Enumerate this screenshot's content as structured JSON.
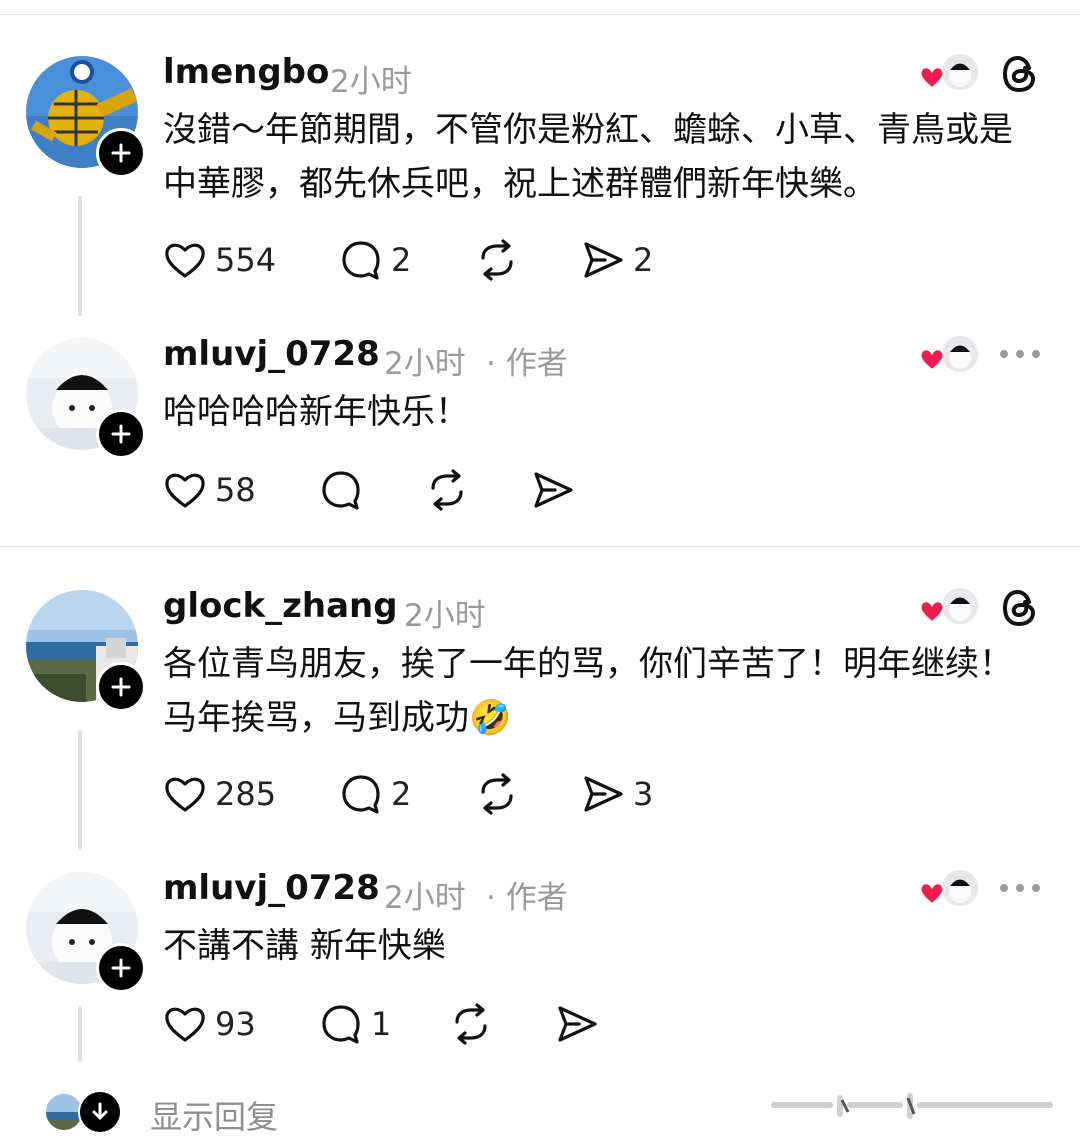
{
  "posts": [
    {
      "username": "lmengbo",
      "time": "2小时",
      "body": "沒錯～年節期間，不管你是粉紅、蟾蜍、小草、青鳥或是中華膠，都先休兵吧，祝上述群體們新年快樂。",
      "likes": "554",
      "comments": "2",
      "reposts": "",
      "shares": "2",
      "corner_icon": "threads-logo-icon"
    },
    {
      "username": "mluvj_0728",
      "time": "2小时",
      "author_tag": "· 作者",
      "body": "哈哈哈哈新年快乐！",
      "likes": "58",
      "comments": "",
      "reposts": "",
      "shares": "",
      "corner_icon": "more-icon"
    },
    {
      "username": "glock_zhang",
      "time": "2小时",
      "body": "各位青鸟朋友，挨了一年的骂，你们辛苦了！明年继续！马年挨骂，马到成功🤣",
      "likes": "285",
      "comments": "2",
      "reposts": "",
      "shares": "3",
      "corner_icon": "threads-logo-icon"
    },
    {
      "username": "mluvj_0728",
      "time": "2小时",
      "author_tag": "· 作者",
      "body": "不講不講 新年快樂",
      "likes": "93",
      "comments": "1",
      "reposts": "",
      "shares": "",
      "corner_icon": "more-icon"
    }
  ],
  "show_replies": {
    "label": "显示回复"
  },
  "colors": {
    "heart": "#ee1d4f",
    "meta": "#9a9a9a",
    "divider": "#e2e2e2",
    "thread_line": "#e0e0e0"
  }
}
